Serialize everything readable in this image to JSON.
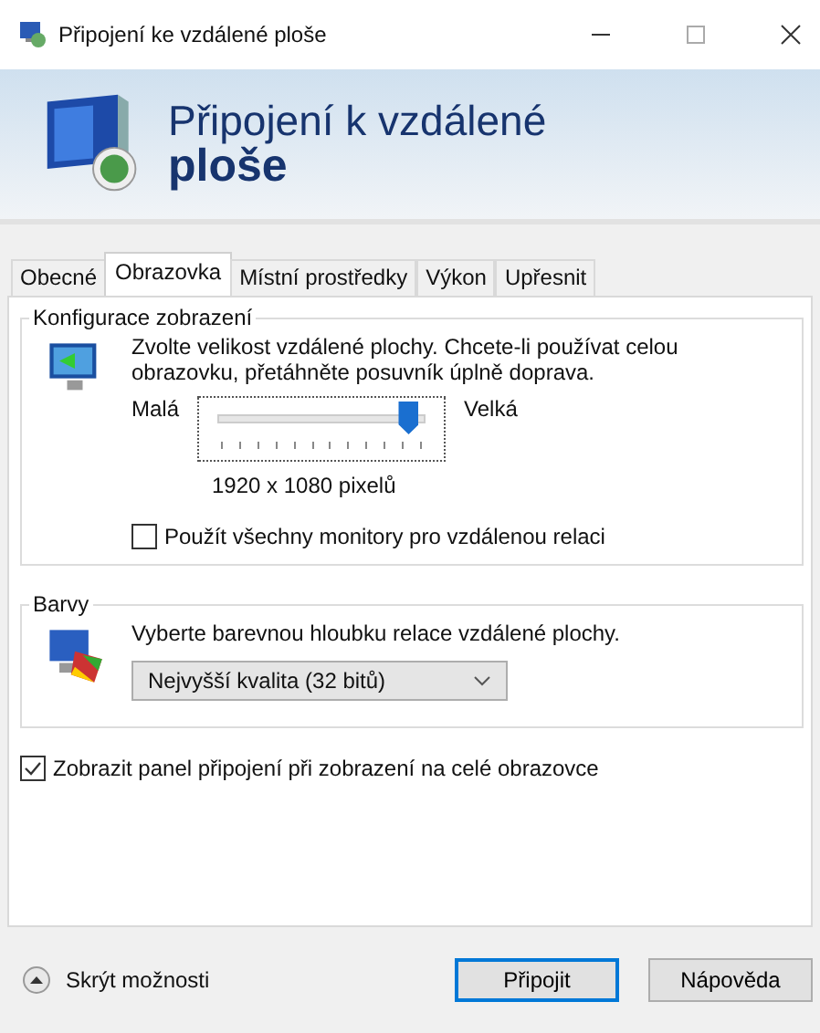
{
  "window": {
    "title": "Připojení ke vzdálené ploše"
  },
  "banner": {
    "line_1": "Připojení k vzdálené",
    "line_2": "ploše"
  },
  "tabs": [
    {
      "label": "Obecné",
      "selected": false
    },
    {
      "label": "Obrazovka",
      "selected": true
    },
    {
      "label": "Místní prostředky",
      "selected": false
    },
    {
      "label": "Výkon",
      "selected": false
    },
    {
      "label": "Upřesnit",
      "selected": false
    }
  ],
  "display_group": {
    "title": "Konfigurace zobrazení",
    "description": "Zvolte velikost vzdálené plochy. Chcete-li používat celou obrazovku, přetáhněte posuvník úplně doprava.",
    "slider": {
      "min_label": "Malá",
      "max_label": "Velká",
      "level": 0.86
    },
    "resolution": "1920 x 1080 pixelů",
    "all_monitors": {
      "label": "Použít všechny monitory pro vzdálenou relaci",
      "checked": false
    }
  },
  "colors_group": {
    "title": "Barvy",
    "description": "Vyberte barevnou hloubku relace vzdálené plochy.",
    "dropdown": {
      "value": "Nejvyšší kvalita (32 bitů)"
    }
  },
  "connection_bar": {
    "label": "Zobrazit panel připojení při zobrazení na celé obrazovce",
    "checked": true
  },
  "footer": {
    "toggle": "Skrýt možnosti",
    "buttons": [
      {
        "label": "Připojit",
        "kind": "default"
      },
      {
        "label": "Nápověda",
        "kind": "normal"
      }
    ]
  }
}
